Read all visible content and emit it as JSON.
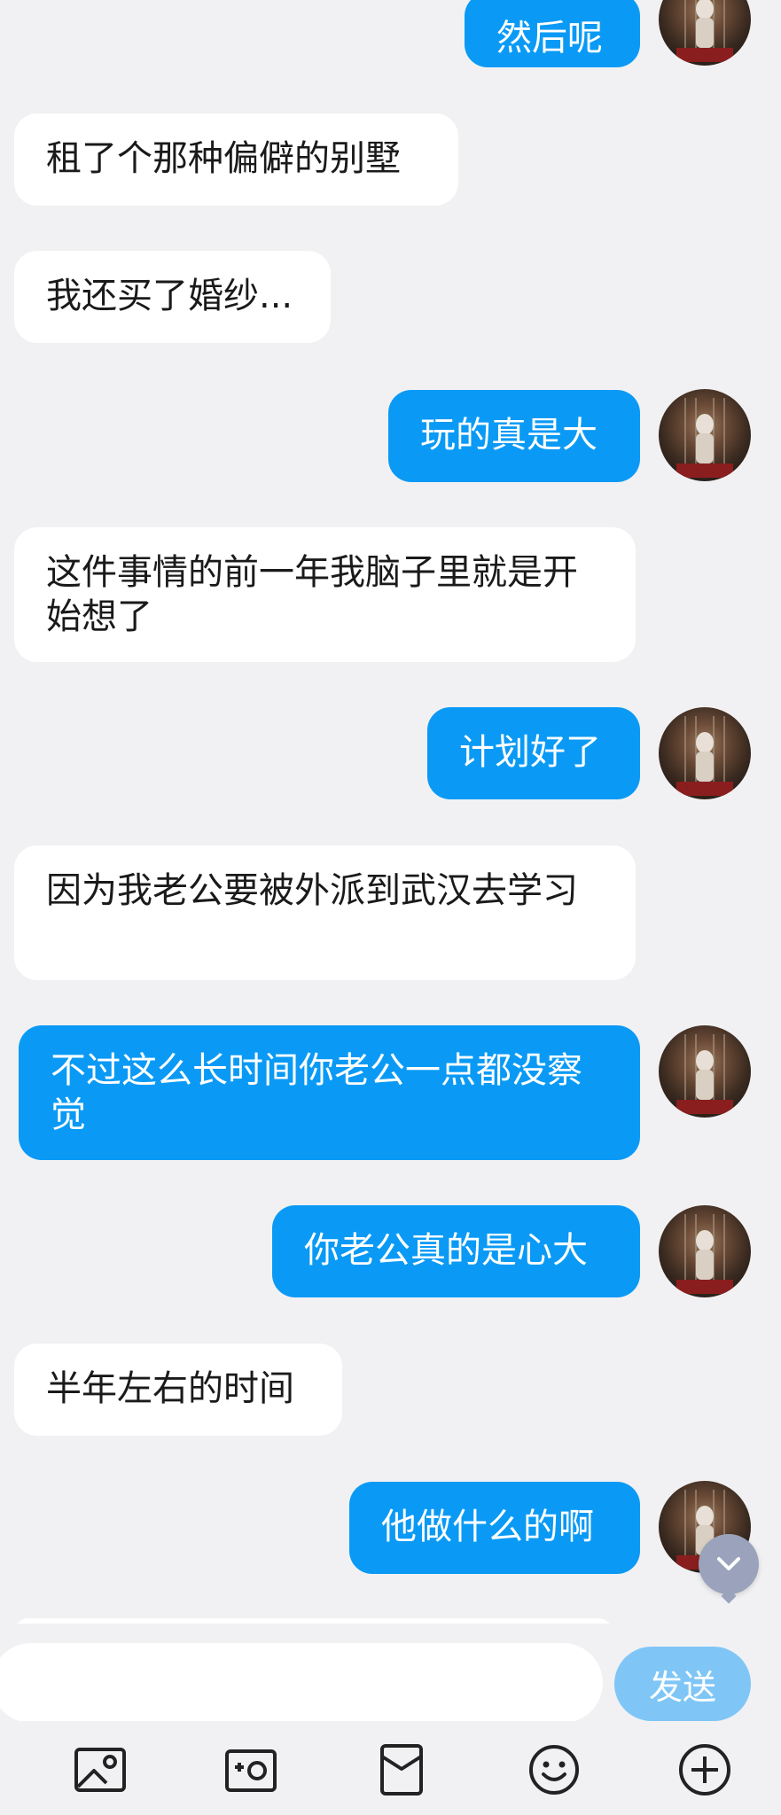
{
  "messages": [
    {
      "side": "out",
      "text": "然后呢"
    },
    {
      "side": "in",
      "text": "租了个那种偏僻的别墅"
    },
    {
      "side": "in",
      "text": "我还买了婚纱..."
    },
    {
      "side": "out",
      "text": "玩的真是大"
    },
    {
      "side": "in",
      "text": "这件事情的前一年我脑子里就是开始想了"
    },
    {
      "side": "out",
      "text": "计划好了"
    },
    {
      "side": "in",
      "text": "因为我老公要被外派到武汉去学习"
    },
    {
      "side": "out",
      "text": "不过这么长时间你老公一点都没察觉"
    },
    {
      "side": "out",
      "text": "你老公真的是心大"
    },
    {
      "side": "in",
      "text": "半年左右的时间"
    },
    {
      "side": "out",
      "text": "他做什么的啊"
    }
  ],
  "input": {
    "value": "",
    "placeholder": ""
  },
  "send_label": "发送",
  "toolbar": [
    {
      "icon": "image-icon"
    },
    {
      "icon": "camera-icon"
    },
    {
      "icon": "red-packet-icon"
    },
    {
      "icon": "emoji-icon"
    },
    {
      "icon": "plus-icon"
    }
  ],
  "colors": {
    "outgoing": "#0a9af5",
    "incoming": "#ffffff",
    "background": "#f1f1f3",
    "send": "#7fc6f6"
  }
}
